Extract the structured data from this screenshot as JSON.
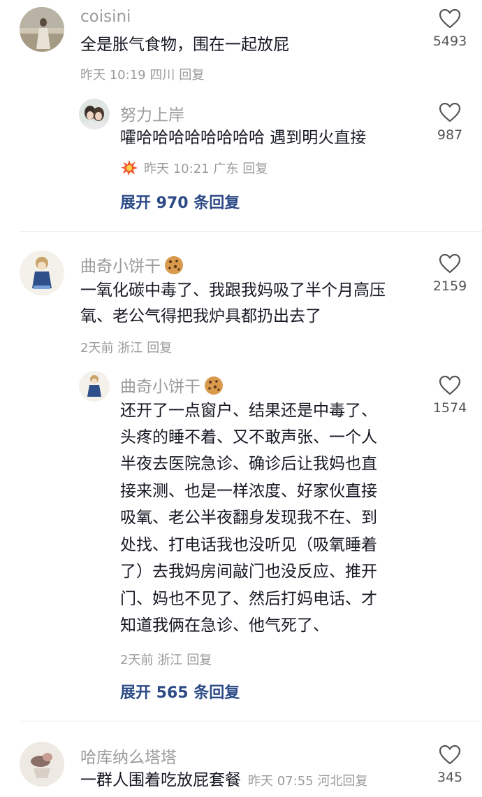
{
  "comments": [
    {
      "user": "coisini",
      "text": "全是胀气食物，围在一起放屁",
      "meta": "昨天 10:19 四川",
      "reply_label": "回复",
      "likes": "5493"
    },
    {
      "user": "努力上岸",
      "text": "嚯哈哈哈哈哈哈哈哈 遇到明火直接",
      "meta": "昨天 10:21 广东",
      "reply_label": "回复",
      "likes": "987"
    },
    {
      "user": "曲奇小饼干",
      "text_lines": [
        "一氧化碳中毒了、我跟我妈吸了半个月高压",
        "氧、老公气得把我炉具都扔出去了"
      ],
      "meta": "2天前 浙江",
      "reply_label": "回复",
      "likes": "2159"
    },
    {
      "user": "曲奇小饼干",
      "text_lines": [
        "还开了一点窗户、结果还是中毒了、",
        "头疼的睡不着、又不敢声张、一个人",
        "半夜去医院急诊、确诊后让我妈也直",
        "接来测、也是一样浓度、好家伙直接",
        "吸氧、老公半夜翻身发现我不在、到",
        "处找、打电话我也没听见（吸氧睡着",
        "了）去我妈房间敲门也没反应、推开",
        "门、妈也不见了、然后打妈电话、才",
        "知道我俩在急诊、他气死了、"
      ],
      "meta": "2天前 浙江",
      "reply_label": "回复",
      "likes": "1574"
    },
    {
      "user": "哈库纳么塔塔",
      "text": "一群人围着吃放屁套餐",
      "meta": "昨天 07:55 河北",
      "reply_label": "回复",
      "likes": "345"
    }
  ],
  "expand_1": "展开 970 条回复",
  "expand_2": "展开 565 条回复",
  "icons": {
    "like": "heart-outline-icon",
    "badge": "explosion-emoji-icon",
    "name_emoji": "cookie-emoji-icon"
  },
  "colors": {
    "link": "#2b4a86",
    "muted": "#9b9b9b",
    "text": "#161823"
  }
}
